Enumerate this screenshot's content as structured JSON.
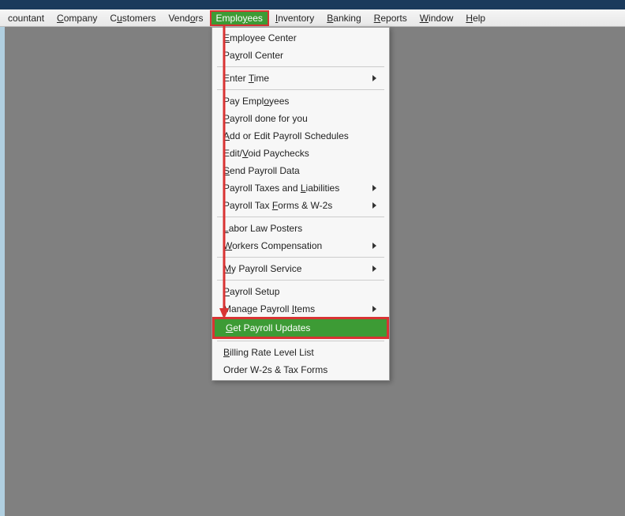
{
  "menubar": {
    "items": [
      {
        "label_pre": "",
        "hotkey": "",
        "label_post": "countant"
      },
      {
        "label_pre": "",
        "hotkey": "C",
        "label_post": "ompany"
      },
      {
        "label_pre": "C",
        "hotkey": "u",
        "label_post": "stomers"
      },
      {
        "label_pre": "Vend",
        "hotkey": "o",
        "label_post": "rs"
      },
      {
        "label_pre": "Emplo",
        "hotkey": "y",
        "label_post": "ees",
        "active": true
      },
      {
        "label_pre": "",
        "hotkey": "I",
        "label_post": "nventory"
      },
      {
        "label_pre": "",
        "hotkey": "B",
        "label_post": "anking"
      },
      {
        "label_pre": "",
        "hotkey": "R",
        "label_post": "eports"
      },
      {
        "label_pre": "",
        "hotkey": "W",
        "label_post": "indow"
      },
      {
        "label_pre": "",
        "hotkey": "H",
        "label_post": "elp"
      }
    ]
  },
  "dropdown": {
    "items": [
      {
        "pre": "",
        "hk": "E",
        "post": "mployee Center"
      },
      {
        "pre": "Pa",
        "hk": "y",
        "post": "roll Center"
      },
      {
        "sep": true
      },
      {
        "pre": "Enter ",
        "hk": "T",
        "post": "ime",
        "submenu": true
      },
      {
        "sep": true
      },
      {
        "pre": "Pay Empl",
        "hk": "o",
        "post": "yees"
      },
      {
        "pre": "",
        "hk": "P",
        "post": "ayroll done for you"
      },
      {
        "pre": "",
        "hk": "A",
        "post": "dd or Edit Payroll Schedules"
      },
      {
        "pre": "Edit/",
        "hk": "V",
        "post": "oid Paychecks"
      },
      {
        "pre": "",
        "hk": "S",
        "post": "end Payroll Data"
      },
      {
        "pre": "Payroll Taxes and ",
        "hk": "L",
        "post": "iabilities",
        "submenu": true
      },
      {
        "pre": "Payroll Tax ",
        "hk": "F",
        "post": "orms & W-2s",
        "submenu": true
      },
      {
        "sep": true
      },
      {
        "pre": "",
        "hk": "L",
        "post": "abor Law Posters"
      },
      {
        "pre": "",
        "hk": "W",
        "post": "orkers Compensation",
        "submenu": true
      },
      {
        "sep": true
      },
      {
        "pre": "",
        "hk": "M",
        "post": "y Payroll Service",
        "submenu": true
      },
      {
        "sep": true
      },
      {
        "pre": "",
        "hk": "P",
        "post": "ayroll Setup"
      },
      {
        "pre": "Manage Payroll ",
        "hk": "I",
        "post": "tems",
        "submenu": true
      },
      {
        "pre": "",
        "hk": "G",
        "post": "et Payroll Updates",
        "highlighted": true,
        "boxed": true
      },
      {
        "sep": true
      },
      {
        "pre": "",
        "hk": "B",
        "post": "illing Rate Level List"
      },
      {
        "pre": "Order W-2s & Tax Forms",
        "hk": "",
        "post": ""
      }
    ]
  },
  "annotation": {
    "arrow_from": "employees-menu",
    "arrow_to": "get-payroll-updates",
    "color": "#d93333"
  }
}
